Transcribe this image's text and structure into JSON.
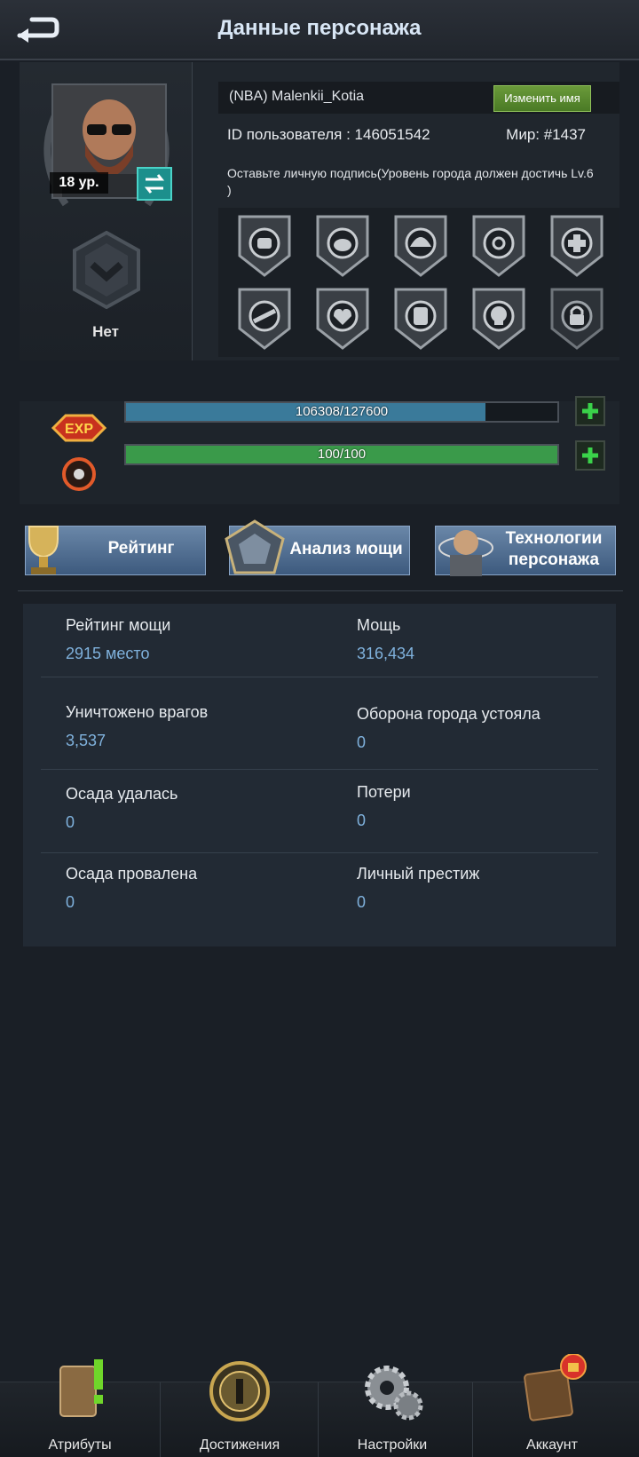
{
  "header": {
    "title": "Данные персонажа"
  },
  "profile": {
    "level_label": "18 ур.",
    "rank_label": "Нет",
    "player_name": "(NBA) Malenkii_Kotia",
    "rename_label": "Изменить имя",
    "user_id_label": "ID пользователя  : 146051542",
    "world_label": "Мир: #1437",
    "signature_text": "Оставьте личную подпись(Уровень города должен достичь Lv.6 )"
  },
  "medals": [
    {
      "icon": "fist-medal-icon",
      "locked": false
    },
    {
      "icon": "frog-medal-icon",
      "locked": false
    },
    {
      "icon": "helmet-medal-icon",
      "locked": false
    },
    {
      "icon": "biohazard-medal-icon",
      "locked": false
    },
    {
      "icon": "medic-cross-medal-icon",
      "locked": false
    },
    {
      "icon": "rifle-medal-icon",
      "locked": false
    },
    {
      "icon": "heart-medal-icon",
      "locked": false
    },
    {
      "icon": "vest-medal-icon",
      "locked": false
    },
    {
      "icon": "skull-medal-icon",
      "locked": false
    },
    {
      "icon": "lock-medal-icon",
      "locked": true
    }
  ],
  "bars": {
    "exp": {
      "text": "106308/127600",
      "current": 106308,
      "max": 127600,
      "fill_color": "#3a7a9a",
      "icon": "exp-icon"
    },
    "stamina": {
      "text": "100/100",
      "current": 100,
      "max": 100,
      "fill_color": "#3a9a4a",
      "icon": "stamina-wheel-icon"
    }
  },
  "tabs": {
    "rating": "Рейтинг",
    "power_analysis": "Анализ мощи",
    "tech_line1": "Технологии",
    "tech_line2": "персонажа"
  },
  "stats": {
    "power_rank_label": "Рейтинг мощи",
    "power_rank_value": "2915 место",
    "power_label": "Мощь",
    "power_value": "316,434",
    "enemies_killed_label": "Уничтожено врагов",
    "enemies_killed_value": "3,537",
    "city_defense_label": "Оборона города устояла",
    "city_defense_value": "0",
    "siege_success_label": "Осада удалась",
    "siege_success_value": "0",
    "losses_label": "Потери",
    "losses_value": "0",
    "siege_fail_label": "Осада провалена",
    "siege_fail_value": "0",
    "prestige_label": "Личный престиж",
    "prestige_value": "0"
  },
  "nav": {
    "attributes": "Атрибуты",
    "achievements": "Достижения",
    "settings": "Настройки",
    "account": "Аккаунт"
  }
}
